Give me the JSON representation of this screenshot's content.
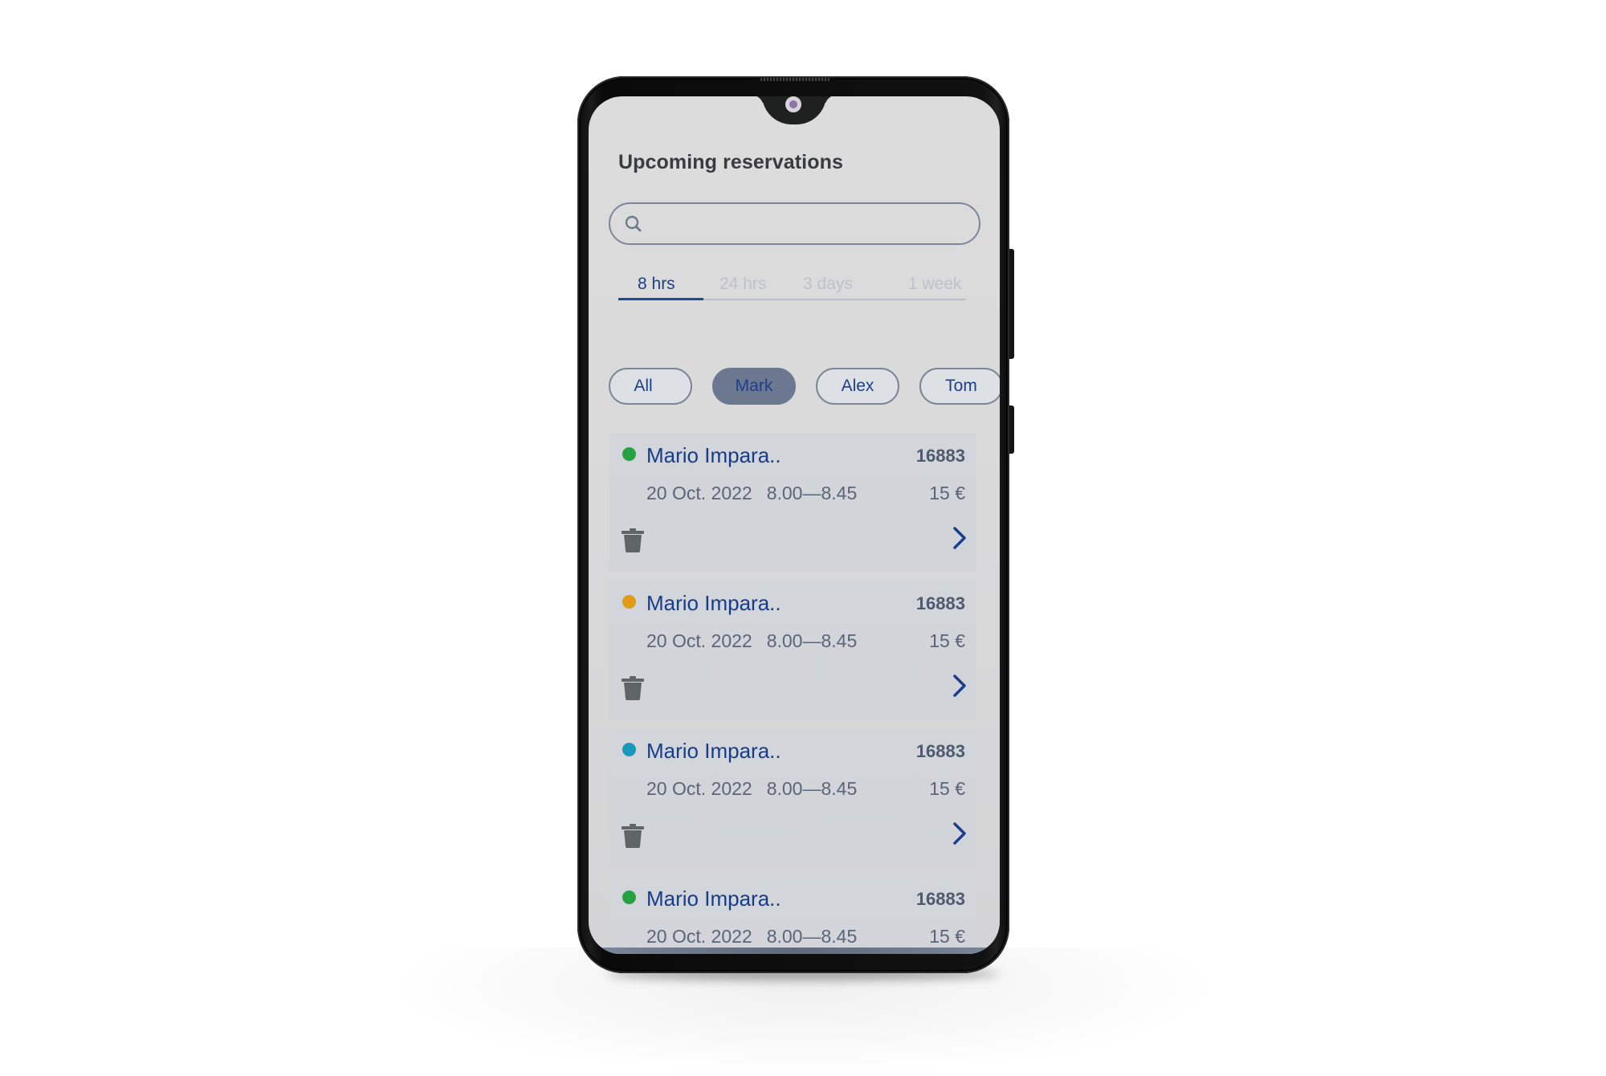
{
  "screen": {
    "title": "Upcoming reservations",
    "search": {
      "placeholder": "",
      "value": ""
    },
    "tabs": [
      {
        "label": "8 hrs",
        "active": true
      },
      {
        "label": "24 hrs",
        "active": false
      },
      {
        "label": "3 days",
        "active": false
      },
      {
        "label": "1 week",
        "active": false
      }
    ],
    "filters": [
      {
        "label": "All",
        "selected": false
      },
      {
        "label": "Mark",
        "selected": true
      },
      {
        "label": "Alex",
        "selected": false
      },
      {
        "label": "Tom",
        "selected": false
      }
    ],
    "reservations": [
      {
        "status_color": "#27a243",
        "name": "Mario Impara..",
        "code": "16883",
        "date": "20 Oct. 2022",
        "time": "8.00—8.45",
        "price": "15 €"
      },
      {
        "status_color": "#e39a14",
        "name": "Mario Impara..",
        "code": "16883",
        "date": "20 Oct. 2022",
        "time": "8.00—8.45",
        "price": "15 €"
      },
      {
        "status_color": "#1898bb",
        "name": "Mario Impara..",
        "code": "16883",
        "date": "20 Oct. 2022",
        "time": "8.00—8.45",
        "price": "15 €"
      },
      {
        "status_color": "#27a243",
        "name": "Mario Impara..",
        "code": "16883",
        "date": "20 Oct. 2022",
        "time": "8.00—8.45",
        "price": "15 €"
      }
    ],
    "icons": {
      "search": "search-icon",
      "delete": "trash-icon",
      "open": "chevron-right-icon"
    },
    "colors": {
      "accent": "#1d3f87",
      "muted_text": "#5a6578",
      "selected_chip": "#6c7890"
    }
  }
}
